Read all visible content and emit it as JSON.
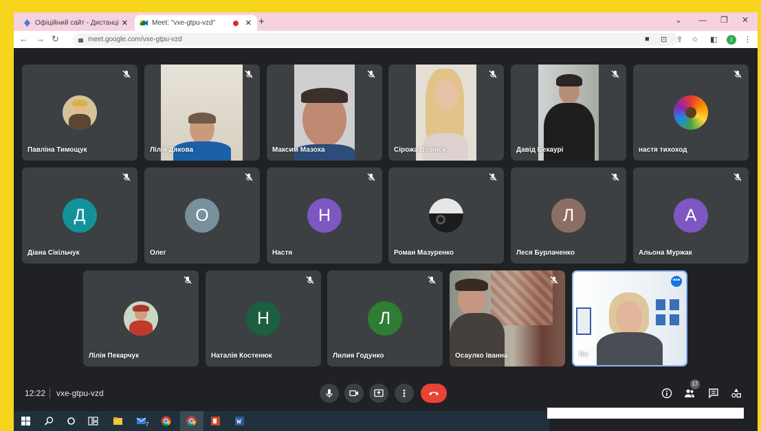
{
  "browser": {
    "tabs": [
      {
        "title": "Офіційний сайт - Дистанційне н",
        "active": false
      },
      {
        "title": "Meet: \"vxe-gtpu-vzd\"",
        "active": true,
        "recording": true
      }
    ],
    "url": "meet.google.com/vxe-gtpu-vzd",
    "profile_initial": "I"
  },
  "participants": [
    {
      "name": "Павліна Тимощук",
      "type": "photo-avatar",
      "muted": true
    },
    {
      "name": "Лілія Дякова",
      "type": "video",
      "muted": true
    },
    {
      "name": "Максим Мазоха",
      "type": "video",
      "muted": true
    },
    {
      "name": "Сірожа Вознюк",
      "type": "video",
      "muted": true
    },
    {
      "name": "Давід Бекаурі",
      "type": "video",
      "muted": true
    },
    {
      "name": "настя тихоход",
      "type": "photo-avatar",
      "muted": true
    },
    {
      "name": "Діана Сікільчук",
      "type": "letter",
      "initial": "Д",
      "color": "#12939a",
      "muted": true
    },
    {
      "name": "Олег",
      "type": "letter",
      "initial": "О",
      "color": "#78909c",
      "muted": true
    },
    {
      "name": "Настя",
      "type": "letter",
      "initial": "Н",
      "color": "#7e57c2",
      "muted": true
    },
    {
      "name": "Роман Мазуренко",
      "type": "photo-avatar",
      "muted": true
    },
    {
      "name": "Леся Бурлаченко",
      "type": "letter",
      "initial": "Л",
      "color": "#8d6e63",
      "muted": true
    },
    {
      "name": "Альона Муржак",
      "type": "letter",
      "initial": "А",
      "color": "#7e57c2",
      "muted": true
    },
    {
      "name": "Лілія Пекарчук",
      "type": "photo-avatar",
      "muted": true
    },
    {
      "name": "Наталія Костенюк",
      "type": "letter",
      "initial": "Н",
      "color": "#1b5e40",
      "muted": true
    },
    {
      "name": "Лилия Годунко",
      "type": "letter",
      "initial": "Л",
      "color": "#2e7d32",
      "muted": true
    },
    {
      "name": "Осаулко Іванна",
      "type": "video",
      "muted": true
    },
    {
      "name": "Ви",
      "type": "video",
      "self": true,
      "muted": false
    }
  ],
  "meeting": {
    "time": "12:22",
    "code": "vxe-gtpu-vzd",
    "participant_count": "17"
  },
  "colors": {
    "background": "#202124",
    "tile": "#3c4043",
    "hangup": "#ea4335",
    "frame_border": "#f7d51d"
  },
  "icons": [
    "mic-off-icon",
    "mic-icon",
    "camera-icon",
    "present-icon",
    "more-vert-icon",
    "hangup-icon",
    "info-icon",
    "people-icon",
    "chat-icon",
    "activities-icon"
  ],
  "taskbar_badge": "7"
}
